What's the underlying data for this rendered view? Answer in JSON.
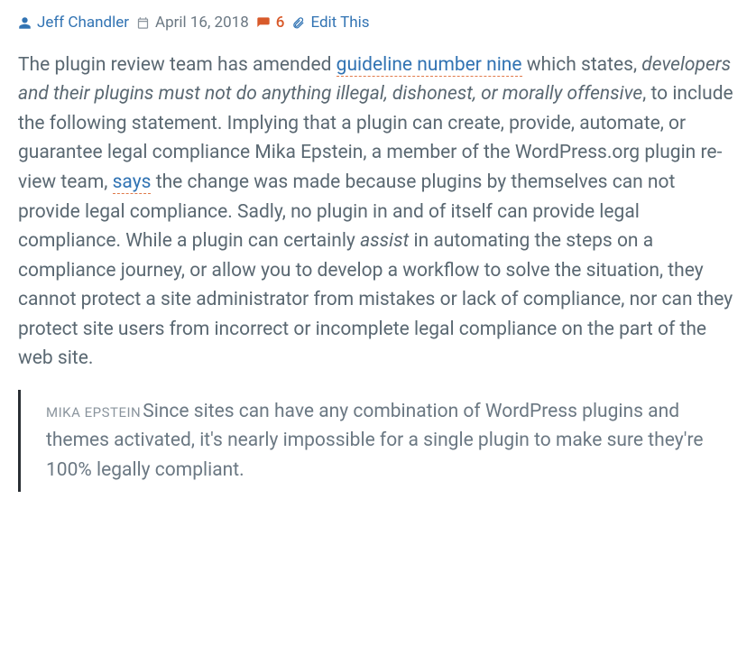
{
  "meta": {
    "author": "Jeff Chandler",
    "date": "April 16, 2018",
    "comments": "6",
    "edit": "Edit This"
  },
  "article": {
    "p1_a": "The plugin review team has amended ",
    "link1": "guideline number nine",
    "p1_b": " which states, ",
    "em1": "developers and their plugins must not do anything illegal, dis­honest, or morally offensive",
    "p1_c": ", to include the following statement. Im­plying that a plugin can create, provide, automate, or guarantee legal compliance Mika Epstein, a member of the WordPress.org plugin re­view team, ",
    "link2": "says",
    "p1_d": " the change was made because plugins by themselves can not provide legal compliance. Sadly, no plugin in and of itself can provide legal compliance. While a plugin can certainly ",
    "em2": "assist",
    "p1_e": " in au­tomating the steps on a compliance journey, or allow you to develop a workflow to solve the situation, they cannot protect a site adminis­trator from mistakes or lack of compliance, nor can they protect site users from incorrect or incomplete legal compliance on the part of the web site."
  },
  "quote": {
    "author": "Mika Epstein",
    "text": "Since sites can have any combination of WordPress plugins and themes activated, it's nearly impossible for a single plugin to make sure they're 100% legally compliant."
  },
  "colors": {
    "link": "#3173b3",
    "accent": "#d85a2a",
    "text": "#5a6872"
  }
}
